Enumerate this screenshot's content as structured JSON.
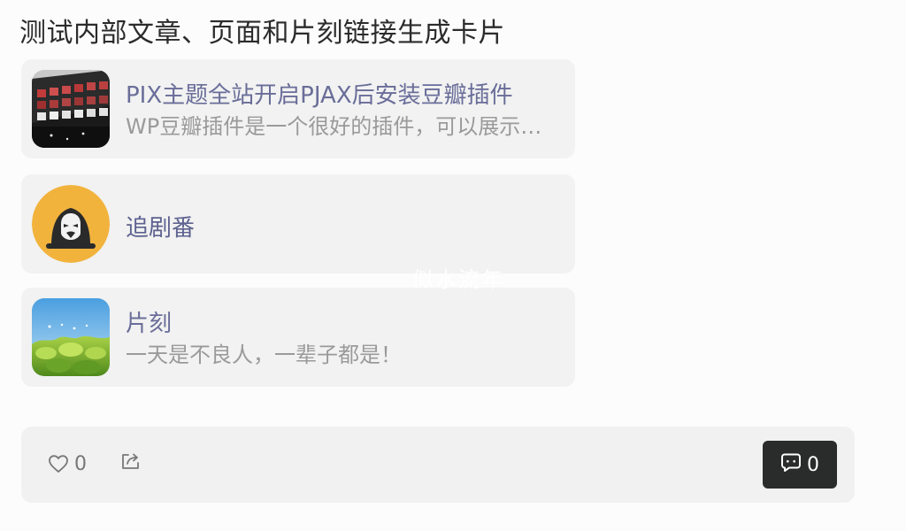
{
  "post": {
    "title": "测试内部文章、页面和片刻链接生成卡片"
  },
  "cards": [
    {
      "title": "PIX主题全站开启PJAX后安装豆瓣插件",
      "description": "WP豆瓣插件是一个很好的插件，可以展示豆瓣的书影音"
    },
    {
      "title": "追剧番"
    },
    {
      "title": "片刻",
      "description": "一天是不良人，一辈子都是！"
    }
  ],
  "watermark": "似水流年",
  "actions": {
    "like_count": "0",
    "comment_count": "0"
  },
  "colors": {
    "accent_link": "#6a6d99",
    "card_bg": "#f1f2f1",
    "avatar_bg": "#f2b33d",
    "comment_button_bg": "#2a2b2b"
  },
  "icons": {
    "like": "heart-outline-icon",
    "share": "share-icon",
    "comment": "comment-icon"
  }
}
